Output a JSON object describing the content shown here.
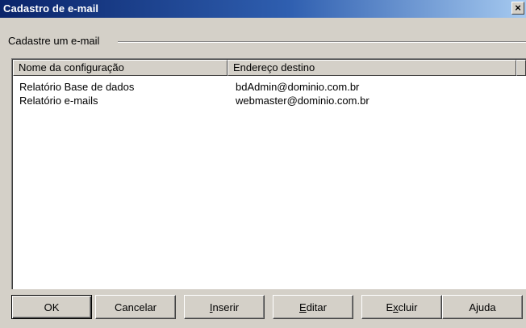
{
  "window": {
    "title": "Cadastro de e-mail",
    "close_glyph": "×"
  },
  "group": {
    "label": "Cadastre um e-mail"
  },
  "list": {
    "columns": [
      "Nome da configuração",
      "Endereço destino"
    ],
    "rows": [
      {
        "name": "Relatório Base de dados",
        "address": "bdAdmin@dominio.com.br"
      },
      {
        "name": "Relatório e-mails",
        "address": "webmaster@dominio.com.br"
      }
    ]
  },
  "buttons": {
    "ok": "OK",
    "cancelar": "Cancelar",
    "inserir": {
      "accel": "I",
      "rest": "nserir"
    },
    "editar": {
      "accel": "E",
      "rest": "ditar"
    },
    "excluir": {
      "pre": "E",
      "accel": "x",
      "rest": "cluir"
    },
    "ajuda": "Ajuda"
  },
  "colors": {
    "face": "#d4d0c8",
    "title_start": "#0a246a",
    "title_end": "#a6caf0"
  }
}
